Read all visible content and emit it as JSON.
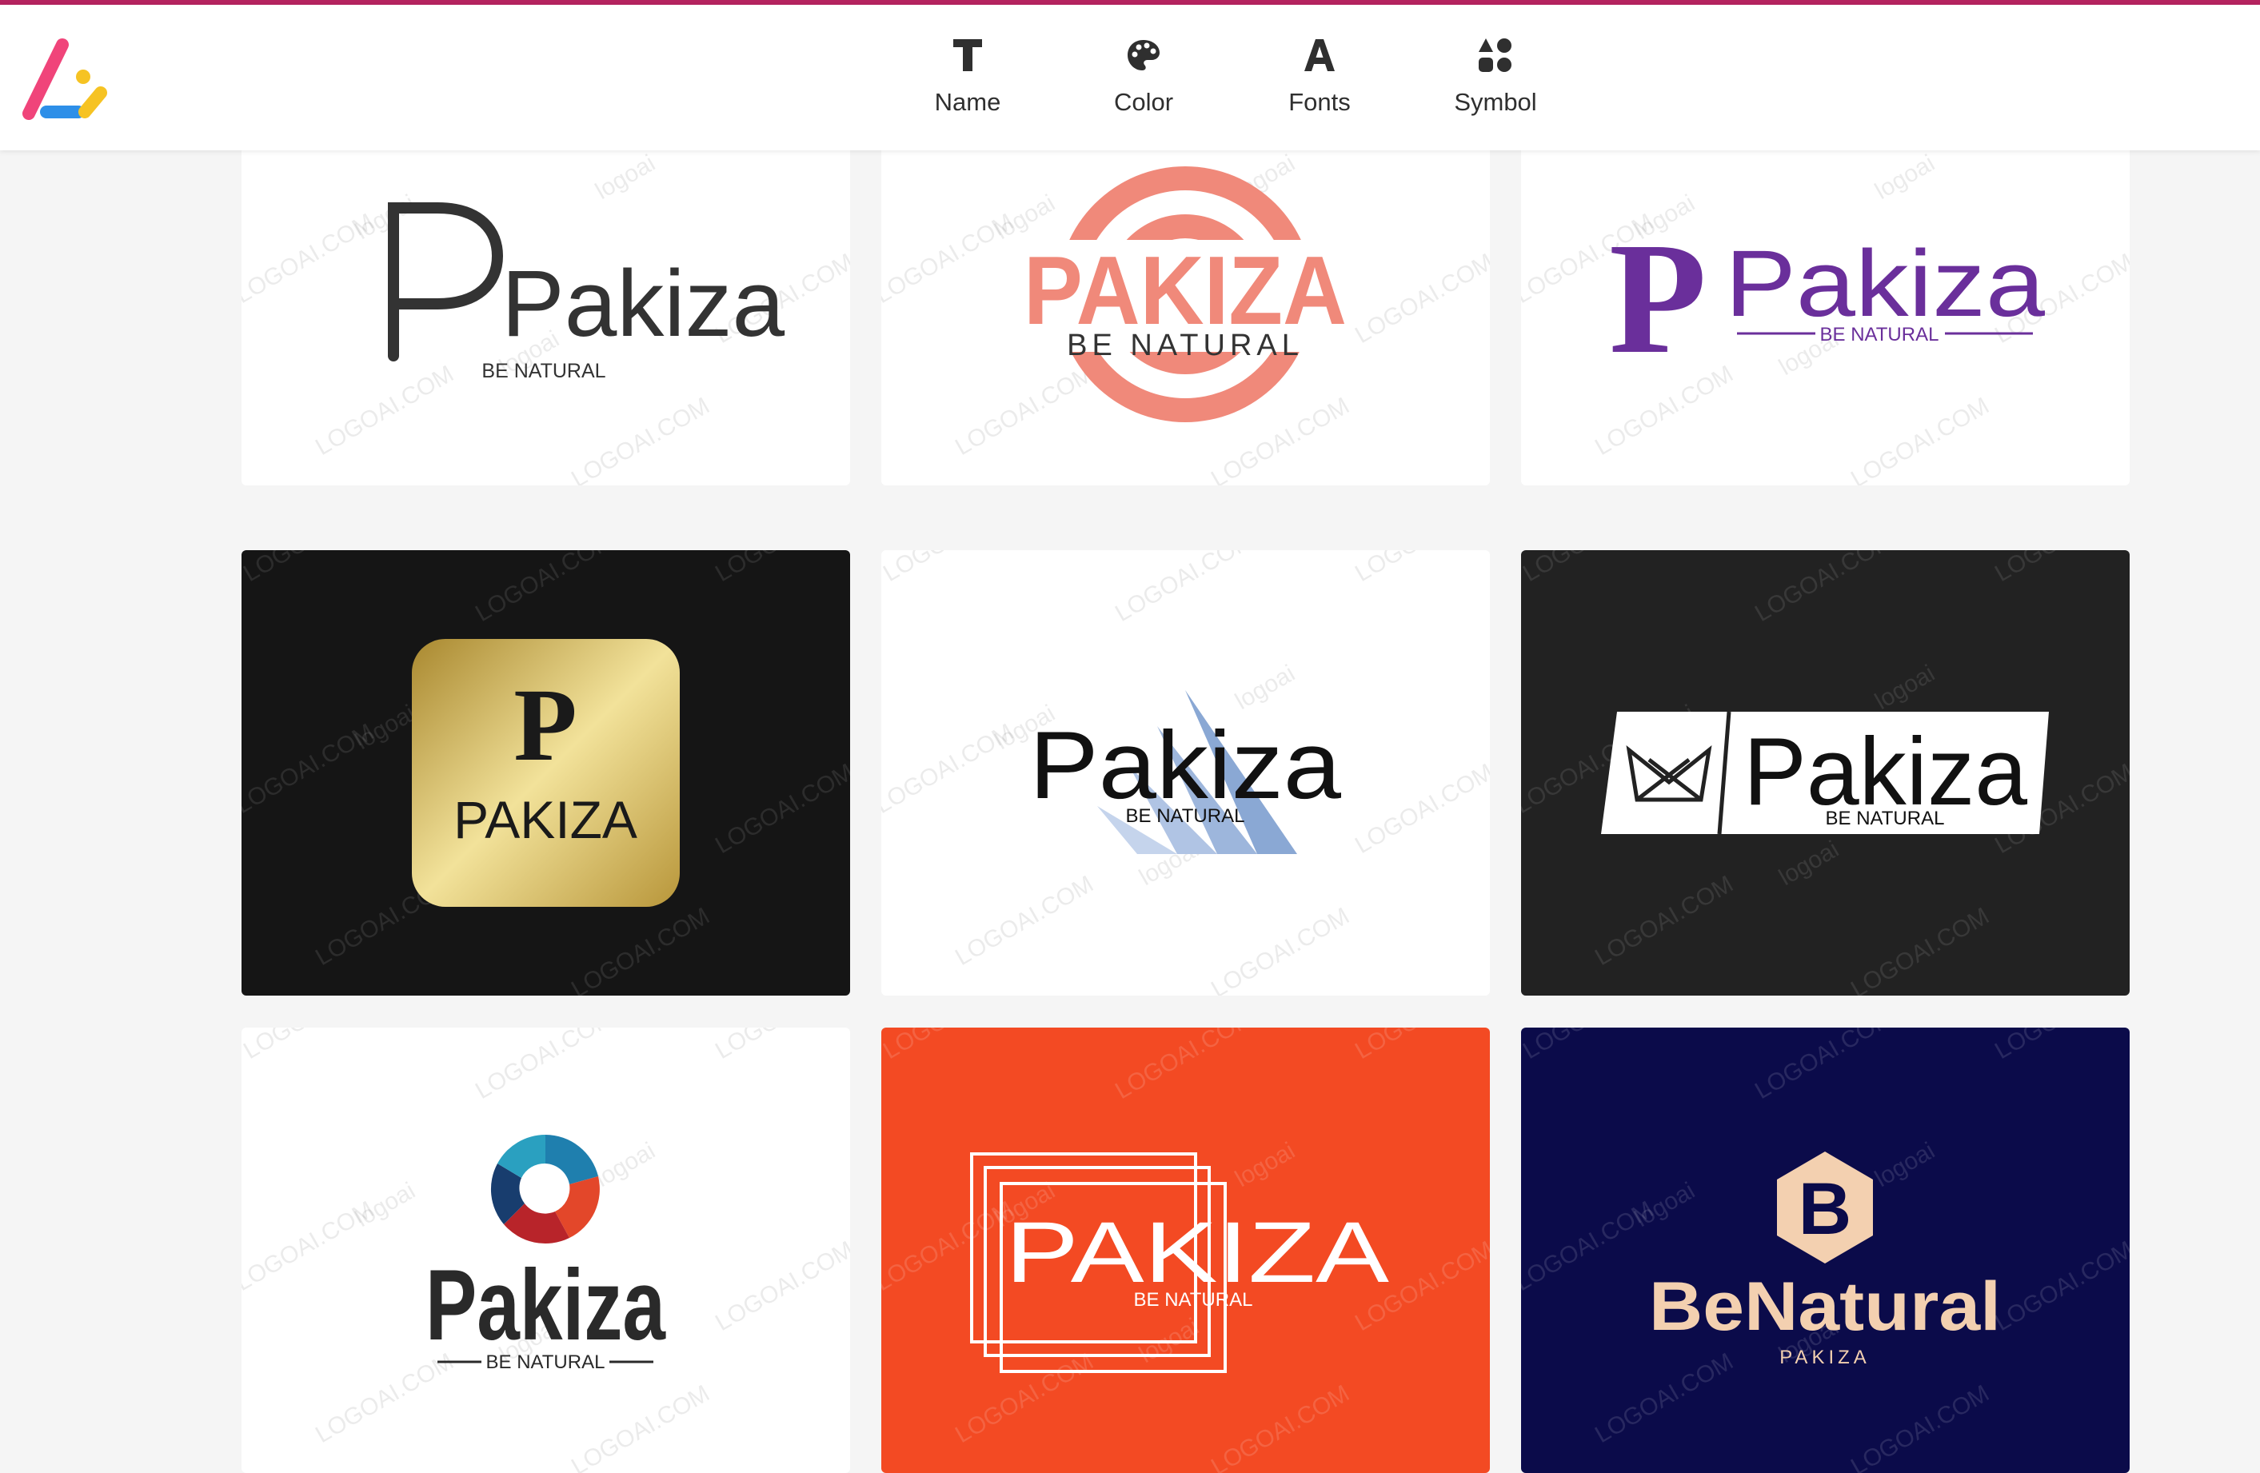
{
  "nav": {
    "items": [
      {
        "label": "Name",
        "icon": "text-t-icon"
      },
      {
        "label": "Color",
        "icon": "palette-icon"
      },
      {
        "label": "Fonts",
        "icon": "font-a-icon"
      },
      {
        "label": "Symbol",
        "icon": "shapes-icon"
      }
    ]
  },
  "watermark": {
    "brand": "logoai",
    "domain": "LOGOAI.COM"
  },
  "logos": [
    {
      "name": "Pakiza",
      "tagline": "BE NATURAL"
    },
    {
      "name": "PAKIZA",
      "tagline": "BE NATURAL"
    },
    {
      "name": "Pakiza",
      "tagline": "BE NATURAL",
      "monogram": "P"
    },
    {
      "name": "PAKIZA",
      "monogram": "P"
    },
    {
      "name": "Pakiza",
      "tagline": "BE NATURAL"
    },
    {
      "name": "Pakiza",
      "tagline": "BE NATURAL"
    },
    {
      "name": "Pakiza",
      "tagline": "BE NATURAL"
    },
    {
      "name": "PAKIZA",
      "tagline": "BE NATURAL"
    },
    {
      "name": "BeNatural",
      "tagline": "PAKIZA",
      "monogram": "B"
    }
  ],
  "colors": {
    "accent": "#b5235f",
    "salmon": "#f0897a",
    "purple": "#6a2f9b",
    "gold": "#d9bf6a",
    "orange": "#f34a23",
    "navy": "#0b0b4a",
    "beige": "#f3d0b0"
  }
}
